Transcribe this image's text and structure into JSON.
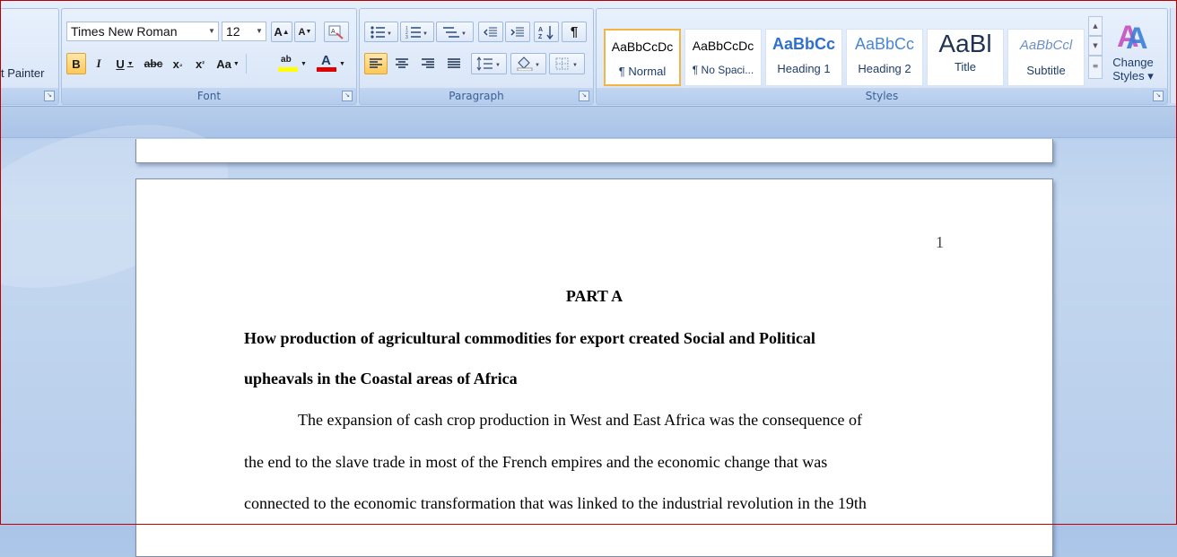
{
  "clipboard": {
    "format_painter_label": "t Painter"
  },
  "font": {
    "group_label": "Font",
    "font_name": "Times New Roman",
    "font_size": "12",
    "grow_label": "A",
    "shrink_label": "A",
    "bold_label": "B",
    "italic_label": "I",
    "underline_label": "U",
    "strike_label": "abc",
    "subscript_label": "x",
    "superscript_label": "x",
    "case_label": "Aa",
    "highlight_label": "ab",
    "font_color_label": "A"
  },
  "paragraph": {
    "group_label": "Paragraph"
  },
  "styles": {
    "group_label": "Styles",
    "items": [
      {
        "sample": "AaBbCcDc",
        "name": "¶ Normal"
      },
      {
        "sample": "AaBbCcDc",
        "name": "¶ No Spaci..."
      },
      {
        "sample": "AaBbCc",
        "name": "Heading 1"
      },
      {
        "sample": "AaBbCc",
        "name": "Heading 2"
      },
      {
        "sample": "AaBl",
        "name": "Title"
      },
      {
        "sample": "AaBbCcl",
        "name": "Subtitle"
      }
    ],
    "change_styles_label_1": "Change",
    "change_styles_label_2": "Styles ▾"
  },
  "document": {
    "page_number": "1",
    "part_title": "PART A",
    "heading_lines": [
      "How production of agricultural commodities for export created Social and Political",
      "upheavals in the Coastal areas of Africa"
    ],
    "body_lines": [
      "The expansion of cash crop production in West and East Africa was the consequence of",
      "the end to the slave trade in most of the French empires and the economic change that was",
      "connected to the economic transformation that was linked to the industrial revolution in the 19th"
    ]
  },
  "colors": {
    "highlight": "#ffff00",
    "font_color": "#e00000",
    "active_style_border": "#f2b544",
    "heading_blue": "#2f6fcf"
  }
}
